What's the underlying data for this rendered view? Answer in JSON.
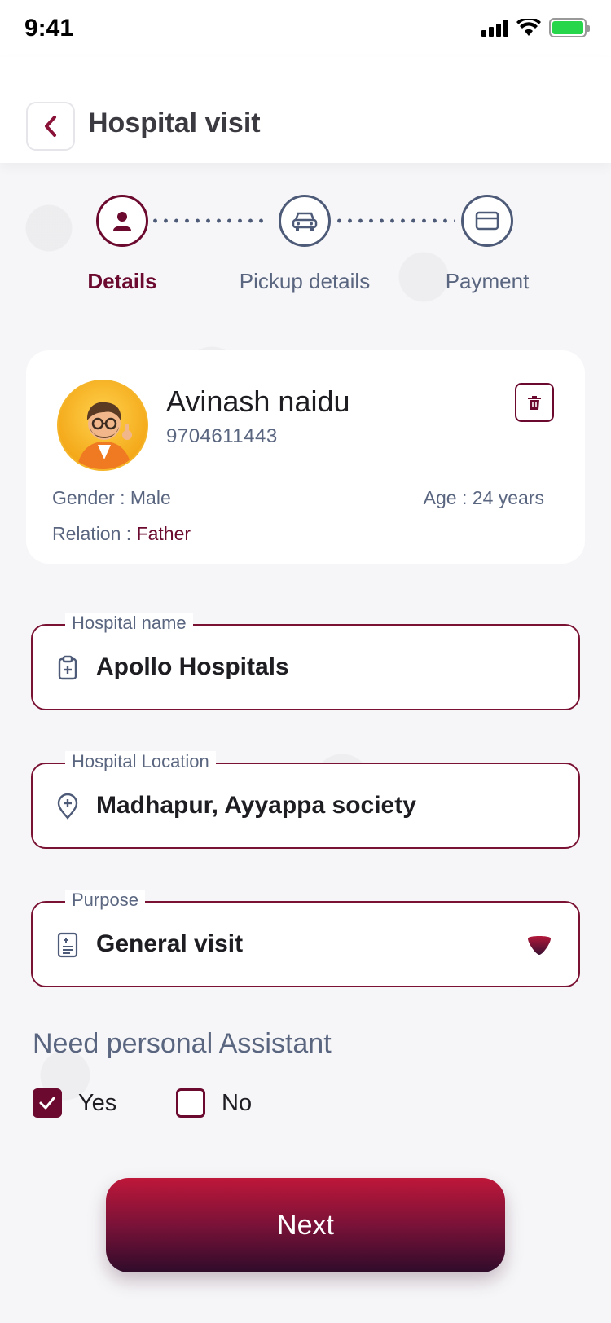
{
  "status_bar": {
    "time": "9:41"
  },
  "header": {
    "title": "Hospital visit",
    "back_icon": "chevron-left-icon"
  },
  "stepper": {
    "steps": [
      {
        "label": "Details",
        "icon": "person-icon",
        "active": true
      },
      {
        "label": "Pickup details",
        "icon": "car-icon",
        "active": false
      },
      {
        "label": "Payment",
        "icon": "card-icon",
        "active": false
      }
    ]
  },
  "patient": {
    "name": "Avinash naidu",
    "phone": "9704611443",
    "gender_label": "Gender : ",
    "gender": "Male",
    "age_label": "Age : ",
    "age": "24 years",
    "relation_label": "Relation : ",
    "relation": "Father"
  },
  "form": {
    "hospital_name": {
      "label": "Hospital name",
      "value": "Apollo Hospitals"
    },
    "hospital_location": {
      "label": "Hospital Location",
      "value": "Madhapur, Ayyappa society"
    },
    "purpose": {
      "label": "Purpose",
      "value": "General visit"
    }
  },
  "assistant": {
    "title": "Need personal Assistant",
    "yes_label": "Yes",
    "no_label": "No",
    "selected": "Yes"
  },
  "next_button": {
    "label": "Next"
  },
  "colors": {
    "accent": "#6b0a2e",
    "muted": "#5a6680",
    "battery": "#27d64a"
  }
}
